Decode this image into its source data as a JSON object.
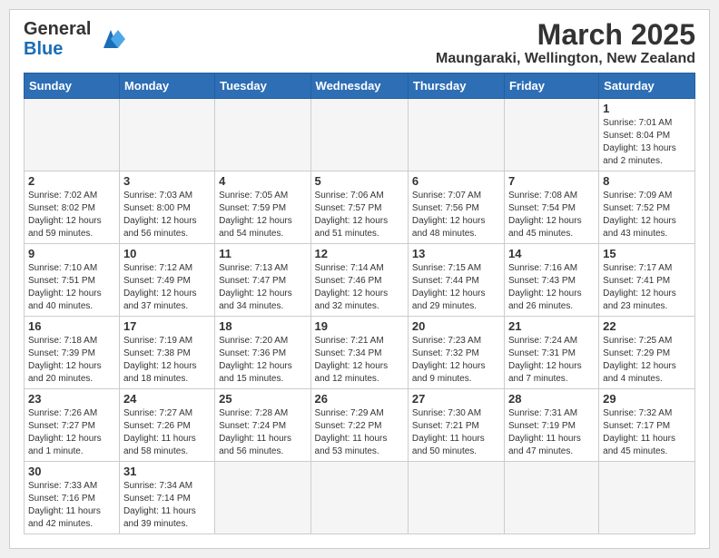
{
  "header": {
    "logo_general": "General",
    "logo_blue": "Blue",
    "title": "March 2025",
    "subtitle": "Maungaraki, Wellington, New Zealand"
  },
  "days_of_week": [
    "Sunday",
    "Monday",
    "Tuesday",
    "Wednesday",
    "Thursday",
    "Friday",
    "Saturday"
  ],
  "weeks": [
    [
      {
        "day": "",
        "info": ""
      },
      {
        "day": "",
        "info": ""
      },
      {
        "day": "",
        "info": ""
      },
      {
        "day": "",
        "info": ""
      },
      {
        "day": "",
        "info": ""
      },
      {
        "day": "",
        "info": ""
      },
      {
        "day": "1",
        "info": "Sunrise: 7:01 AM\nSunset: 8:04 PM\nDaylight: 13 hours\nand 2 minutes."
      }
    ],
    [
      {
        "day": "2",
        "info": "Sunrise: 7:02 AM\nSunset: 8:02 PM\nDaylight: 12 hours\nand 59 minutes."
      },
      {
        "day": "3",
        "info": "Sunrise: 7:03 AM\nSunset: 8:00 PM\nDaylight: 12 hours\nand 56 minutes."
      },
      {
        "day": "4",
        "info": "Sunrise: 7:05 AM\nSunset: 7:59 PM\nDaylight: 12 hours\nand 54 minutes."
      },
      {
        "day": "5",
        "info": "Sunrise: 7:06 AM\nSunset: 7:57 PM\nDaylight: 12 hours\nand 51 minutes."
      },
      {
        "day": "6",
        "info": "Sunrise: 7:07 AM\nSunset: 7:56 PM\nDaylight: 12 hours\nand 48 minutes."
      },
      {
        "day": "7",
        "info": "Sunrise: 7:08 AM\nSunset: 7:54 PM\nDaylight: 12 hours\nand 45 minutes."
      },
      {
        "day": "8",
        "info": "Sunrise: 7:09 AM\nSunset: 7:52 PM\nDaylight: 12 hours\nand 43 minutes."
      }
    ],
    [
      {
        "day": "9",
        "info": "Sunrise: 7:10 AM\nSunset: 7:51 PM\nDaylight: 12 hours\nand 40 minutes."
      },
      {
        "day": "10",
        "info": "Sunrise: 7:12 AM\nSunset: 7:49 PM\nDaylight: 12 hours\nand 37 minutes."
      },
      {
        "day": "11",
        "info": "Sunrise: 7:13 AM\nSunset: 7:47 PM\nDaylight: 12 hours\nand 34 minutes."
      },
      {
        "day": "12",
        "info": "Sunrise: 7:14 AM\nSunset: 7:46 PM\nDaylight: 12 hours\nand 32 minutes."
      },
      {
        "day": "13",
        "info": "Sunrise: 7:15 AM\nSunset: 7:44 PM\nDaylight: 12 hours\nand 29 minutes."
      },
      {
        "day": "14",
        "info": "Sunrise: 7:16 AM\nSunset: 7:43 PM\nDaylight: 12 hours\nand 26 minutes."
      },
      {
        "day": "15",
        "info": "Sunrise: 7:17 AM\nSunset: 7:41 PM\nDaylight: 12 hours\nand 23 minutes."
      }
    ],
    [
      {
        "day": "16",
        "info": "Sunrise: 7:18 AM\nSunset: 7:39 PM\nDaylight: 12 hours\nand 20 minutes."
      },
      {
        "day": "17",
        "info": "Sunrise: 7:19 AM\nSunset: 7:38 PM\nDaylight: 12 hours\nand 18 minutes."
      },
      {
        "day": "18",
        "info": "Sunrise: 7:20 AM\nSunset: 7:36 PM\nDaylight: 12 hours\nand 15 minutes."
      },
      {
        "day": "19",
        "info": "Sunrise: 7:21 AM\nSunset: 7:34 PM\nDaylight: 12 hours\nand 12 minutes."
      },
      {
        "day": "20",
        "info": "Sunrise: 7:23 AM\nSunset: 7:32 PM\nDaylight: 12 hours\nand 9 minutes."
      },
      {
        "day": "21",
        "info": "Sunrise: 7:24 AM\nSunset: 7:31 PM\nDaylight: 12 hours\nand 7 minutes."
      },
      {
        "day": "22",
        "info": "Sunrise: 7:25 AM\nSunset: 7:29 PM\nDaylight: 12 hours\nand 4 minutes."
      }
    ],
    [
      {
        "day": "23",
        "info": "Sunrise: 7:26 AM\nSunset: 7:27 PM\nDaylight: 12 hours\nand 1 minute."
      },
      {
        "day": "24",
        "info": "Sunrise: 7:27 AM\nSunset: 7:26 PM\nDaylight: 11 hours\nand 58 minutes."
      },
      {
        "day": "25",
        "info": "Sunrise: 7:28 AM\nSunset: 7:24 PM\nDaylight: 11 hours\nand 56 minutes."
      },
      {
        "day": "26",
        "info": "Sunrise: 7:29 AM\nSunset: 7:22 PM\nDaylight: 11 hours\nand 53 minutes."
      },
      {
        "day": "27",
        "info": "Sunrise: 7:30 AM\nSunset: 7:21 PM\nDaylight: 11 hours\nand 50 minutes."
      },
      {
        "day": "28",
        "info": "Sunrise: 7:31 AM\nSunset: 7:19 PM\nDaylight: 11 hours\nand 47 minutes."
      },
      {
        "day": "29",
        "info": "Sunrise: 7:32 AM\nSunset: 7:17 PM\nDaylight: 11 hours\nand 45 minutes."
      }
    ],
    [
      {
        "day": "30",
        "info": "Sunrise: 7:33 AM\nSunset: 7:16 PM\nDaylight: 11 hours\nand 42 minutes."
      },
      {
        "day": "31",
        "info": "Sunrise: 7:34 AM\nSunset: 7:14 PM\nDaylight: 11 hours\nand 39 minutes."
      },
      {
        "day": "",
        "info": ""
      },
      {
        "day": "",
        "info": ""
      },
      {
        "day": "",
        "info": ""
      },
      {
        "day": "",
        "info": ""
      },
      {
        "day": "",
        "info": ""
      }
    ]
  ]
}
